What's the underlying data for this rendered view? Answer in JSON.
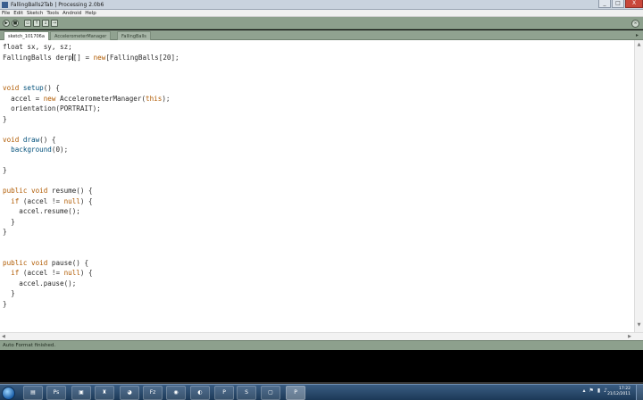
{
  "window": {
    "title": "FallingBalls2Tab | Processing 2.0b6",
    "controls": [
      "_",
      "□",
      "X"
    ]
  },
  "menubar": [
    "File",
    "Edit",
    "Sketch",
    "Tools",
    "Android",
    "Help"
  ],
  "toolbar": {
    "buttons": [
      {
        "name": "run-icon",
        "glyph": "▶"
      },
      {
        "name": "stop-icon",
        "glyph": "■"
      },
      {
        "name": "new-icon",
        "glyph": "▫"
      },
      {
        "name": "open-icon",
        "glyph": "↑"
      },
      {
        "name": "save-icon",
        "glyph": "↓"
      },
      {
        "name": "export-icon",
        "glyph": "→"
      }
    ],
    "mode_glyph": "∞"
  },
  "tabs": [
    "sketch_101706a",
    "AccelerometerManager",
    "FallingBalls"
  ],
  "tab_arrow": "▸",
  "editor": {
    "lines": [
      [
        {
          "t": "float sx, sy, sz;",
          "c": "ty-first"
        }
      ],
      [
        {
          "t": "FallingBalls derp",
          "c": ""
        },
        {
          "caret": true
        },
        {
          "t": "[] = ",
          "c": ""
        },
        {
          "t": "new",
          "c": "kw"
        },
        {
          "t": "[FallingBalls[20];",
          "c": ""
        }
      ],
      [],
      [],
      [
        {
          "t": "void ",
          "c": "kw"
        },
        {
          "t": "setup",
          "c": "fn"
        },
        {
          "t": "() {",
          "c": ""
        }
      ],
      [
        {
          "t": "  accel = ",
          "c": ""
        },
        {
          "t": "new",
          "c": "kw"
        },
        {
          "t": " AccelerometerManager(",
          "c": ""
        },
        {
          "t": "this",
          "c": "kw"
        },
        {
          "t": ");",
          "c": ""
        }
      ],
      [
        {
          "t": "  orientation(PORTRAIT);",
          "c": ""
        }
      ],
      [
        {
          "t": "}",
          "c": ""
        }
      ],
      [],
      [
        {
          "t": "void ",
          "c": "kw"
        },
        {
          "t": "draw",
          "c": "fn"
        },
        {
          "t": "() {",
          "c": ""
        }
      ],
      [
        {
          "t": "  ",
          "c": ""
        },
        {
          "t": "background",
          "c": "fn"
        },
        {
          "t": "(0);",
          "c": ""
        }
      ],
      [],
      [
        {
          "t": "}",
          "c": ""
        }
      ],
      [],
      [
        {
          "t": "public void ",
          "c": "kw"
        },
        {
          "t": "resume() {",
          "c": ""
        }
      ],
      [
        {
          "t": "  if",
          "c": "kw"
        },
        {
          "t": " (accel != ",
          "c": ""
        },
        {
          "t": "null",
          "c": "kw"
        },
        {
          "t": ") {",
          "c": ""
        }
      ],
      [
        {
          "t": "    accel.resume();",
          "c": ""
        }
      ],
      [
        {
          "t": "  }",
          "c": ""
        }
      ],
      [
        {
          "t": "}",
          "c": ""
        }
      ],
      [],
      [],
      [
        {
          "t": "public void ",
          "c": "kw"
        },
        {
          "t": "pause() {",
          "c": ""
        }
      ],
      [
        {
          "t": "  if",
          "c": "kw"
        },
        {
          "t": " (accel != ",
          "c": ""
        },
        {
          "t": "null",
          "c": "kw"
        },
        {
          "t": ") {",
          "c": ""
        }
      ],
      [
        {
          "t": "    accel.pause();",
          "c": ""
        }
      ],
      [
        {
          "t": "  }",
          "c": ""
        }
      ],
      [
        {
          "t": "}",
          "c": ""
        }
      ]
    ]
  },
  "status": {
    "message": "Auto Format finished."
  },
  "taskbar": {
    "apps": [
      {
        "name": "explorer-icon",
        "glyph": "▤"
      },
      {
        "name": "photoshop-icon",
        "glyph": "Ps"
      },
      {
        "name": "media-icon",
        "glyph": "▣"
      },
      {
        "name": "app-icon-4",
        "glyph": "♜"
      },
      {
        "name": "app-icon-5",
        "glyph": "◕"
      },
      {
        "name": "filezilla-icon",
        "glyph": "Fz"
      },
      {
        "name": "chrome-icon",
        "glyph": "◉"
      },
      {
        "name": "eclipse-icon",
        "glyph": "◐"
      },
      {
        "name": "processing-icon",
        "glyph": "P"
      },
      {
        "name": "skype-icon",
        "glyph": "S"
      },
      {
        "name": "app-icon-11",
        "glyph": "▢"
      },
      {
        "name": "processing-active-icon",
        "glyph": "P"
      }
    ],
    "tray_glyphs": [
      "▴",
      "⚑",
      "▮",
      "♪"
    ],
    "time": "17:22",
    "date": "21/12/2011"
  }
}
